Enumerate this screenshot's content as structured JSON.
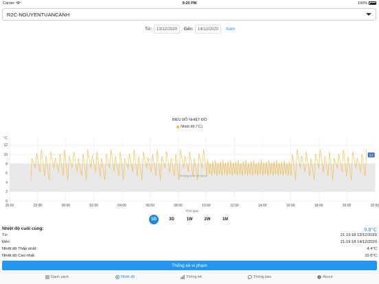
{
  "status_bar": {
    "carrier": "Carrier",
    "time": "9:20 PM",
    "battery": "100%"
  },
  "station": {
    "selected": "R2C-NGUYENTUANCANH"
  },
  "date_filter": {
    "from_label": "Từ:",
    "from_value": "13/12/2020",
    "to_label": "Đến:",
    "to_value": "14/12/2020",
    "view_label": "Xem"
  },
  "chart_data": {
    "type": "line",
    "title": "BIỂU ĐỒ NHIỆT ĐỘ",
    "series": [
      {
        "name": "Nhiệt độ (°C)",
        "color": "#f5b82e"
      }
    ],
    "ylabel": "°C",
    "xlabel": "Thời gian",
    "yticks": [
      "0",
      "2",
      "4",
      "6",
      "8",
      "10",
      "12"
    ],
    "ylim": [
      0,
      12.5
    ],
    "xticks": [
      "20:00",
      "22:00",
      "00:00",
      "02:00",
      "04:00",
      "06:00",
      "08:00",
      "10:00",
      "12:00",
      "14:00",
      "16:00",
      "18:00",
      "20:00",
      "22:00"
    ],
    "xlim_hours": [
      20,
      46
    ],
    "data_start_hour": 21.5,
    "data_end_hour": 45.35,
    "safe_zone": {
      "label": "Khoảng nhiệt độ hợp lệ",
      "low": 2,
      "high": 8
    },
    "cycle": {
      "peak_high": 11.5,
      "peak_low": 9.2,
      "trough_high": 7.9,
      "trough_low": 4.5,
      "period_hours": 0.33
    },
    "last_value_label": "9.8",
    "grid": true,
    "legend": "top-center"
  },
  "range_tabs": [
    "1D",
    "3D",
    "1W",
    "2W",
    "1M"
  ],
  "active_range": "1D",
  "stats": {
    "title": "Nhiệt độ cuối cùng:",
    "last_value": "9.8°C",
    "rows": [
      {
        "label": "Từ:",
        "value": "21:19:18 13/12/2020"
      },
      {
        "label": "Đến:",
        "value": "21:19:18 14/12/2020"
      },
      {
        "label": "Nhiệt độ Thấp nhất:",
        "value": "4.4°C"
      },
      {
        "label": "Nhiệt độ Cao nhất:",
        "value": "10.6°C"
      }
    ]
  },
  "violation_button": {
    "label": "Thống kê vi phạm"
  },
  "tabs": [
    {
      "label": "Danh sách",
      "icon": "list-icon"
    },
    {
      "label": "Nhiệt độ",
      "icon": "thermometer-icon"
    },
    {
      "label": "Thống kê",
      "icon": "bar-chart-icon"
    },
    {
      "label": "Thông báo",
      "icon": "chat-icon"
    },
    {
      "label": "About",
      "icon": "info-icon"
    }
  ],
  "active_tab": "Nhiệt độ",
  "colors": {
    "accent": "#1e88e5",
    "button": "#2196f3",
    "series": "#f5b82e",
    "safe_zone": "#e8e8e8"
  }
}
